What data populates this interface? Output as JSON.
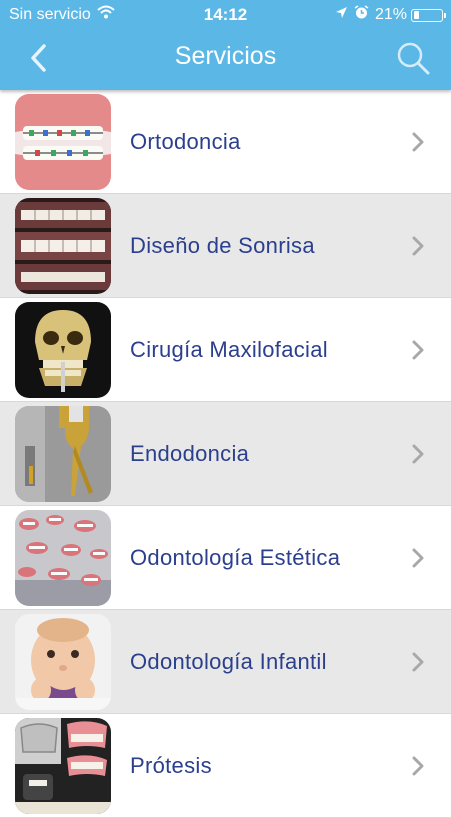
{
  "status_bar": {
    "carrier": "Sin servicio",
    "time": "14:12",
    "battery_percent_label": "21%",
    "battery_level": 0.21
  },
  "nav": {
    "title": "Servicios",
    "back_icon": "chevron-left-icon",
    "search_icon": "search-icon"
  },
  "services": [
    {
      "label": "Ortodoncia",
      "image": "braces-photo"
    },
    {
      "label": "Diseño de Sonrisa",
      "image": "smile-design-photo"
    },
    {
      "label": "Cirugía Maxilofacial",
      "image": "skull-xray-photo"
    },
    {
      "label": "Endodoncia",
      "image": "root-canal-photo"
    },
    {
      "label": "Odontología Estética",
      "image": "smiles-collage-photo"
    },
    {
      "label": "Odontología Infantil",
      "image": "baby-photo"
    },
    {
      "label": "Prótesis",
      "image": "dentures-photo"
    }
  ],
  "colors": {
    "header": "#5bb7e6",
    "label_text": "#2b3f8c",
    "row_alt": "#e8e8e8",
    "chevron": "#a8a8a8"
  }
}
